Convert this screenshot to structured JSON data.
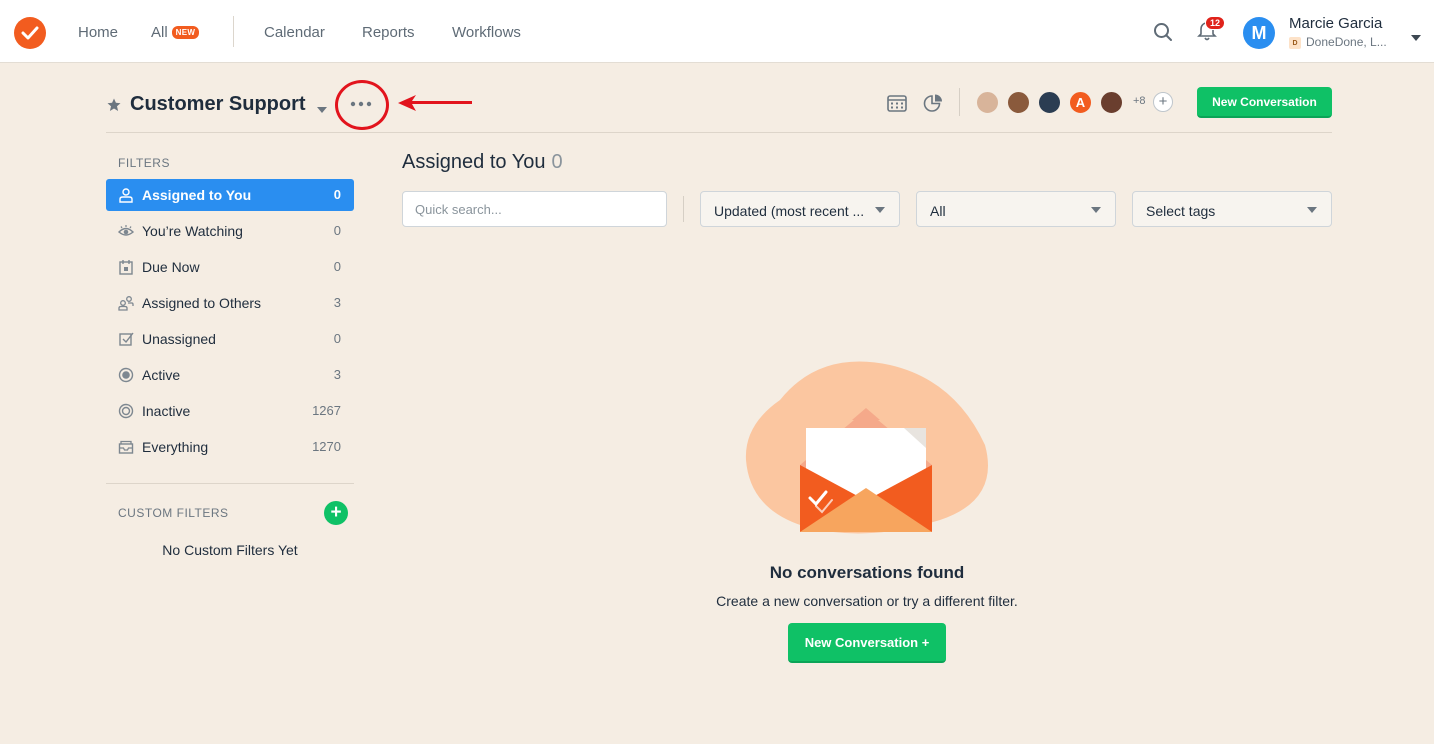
{
  "nav": {
    "items": [
      "Home",
      "All",
      "Calendar",
      "Reports",
      "Workflows"
    ],
    "all_badge": "NEW",
    "notifications_count": "12",
    "user": {
      "initial": "M",
      "name": "Marcie Garcia",
      "org_initial": "D",
      "org": "DoneDone, L..."
    }
  },
  "header": {
    "title": "Customer Support",
    "members_more": "+8",
    "member_initial": "A",
    "new_conversation": "New Conversation"
  },
  "sidebar": {
    "filters_label": "FILTERS",
    "filters": [
      {
        "label": "Assigned to You",
        "count": "0",
        "icon": "user-icon"
      },
      {
        "label": "You’re Watching",
        "count": "0",
        "icon": "eye-icon"
      },
      {
        "label": "Due Now",
        "count": "0",
        "icon": "calendar-icon"
      },
      {
        "label": "Assigned to Others",
        "count": "3",
        "icon": "users-icon"
      },
      {
        "label": "Unassigned",
        "count": "0",
        "icon": "checkbox-icon"
      },
      {
        "label": "Active",
        "count": "3",
        "icon": "radio-filled-icon"
      },
      {
        "label": "Inactive",
        "count": "1267",
        "icon": "radio-ring-icon"
      },
      {
        "label": "Everything",
        "count": "1270",
        "icon": "inbox-icon"
      }
    ],
    "custom_label": "CUSTOM FILTERS",
    "no_custom": "No Custom Filters Yet"
  },
  "main": {
    "title": "Assigned to You",
    "count": "0",
    "search_placeholder": "Quick search...",
    "sort_value": "Updated (most recent ...",
    "status_value": "All",
    "tags_value": "Select tags",
    "empty_title": "No conversations found",
    "empty_sub": "Create a new conversation or try a different filter.",
    "empty_button": "New Conversation +"
  },
  "colors": {
    "brand": "#f25c1f",
    "accent": "#2a8ef0",
    "green": "#0fc166",
    "annotation": "#e2141d"
  }
}
